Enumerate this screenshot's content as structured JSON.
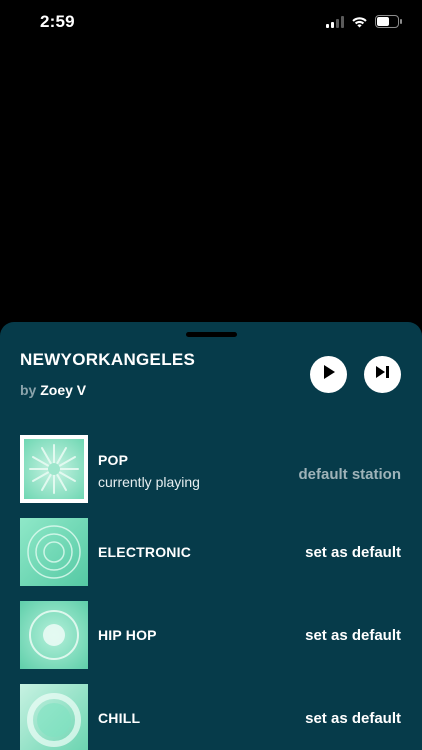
{
  "status_bar": {
    "time": "2:59"
  },
  "sheet": {
    "title": "NEWYORKANGELES",
    "by_word": "by",
    "author": "Zoey V"
  },
  "stations": [
    {
      "name": "POP",
      "subtitle": "currently playing",
      "action": "default station"
    },
    {
      "name": "ELECTRONIC",
      "subtitle": "",
      "action": "set as default"
    },
    {
      "name": "HIP HOP",
      "subtitle": "",
      "action": "set as default"
    },
    {
      "name": "CHILL",
      "subtitle": "",
      "action": "set as default"
    }
  ],
  "colors": {
    "sheet_bg": "#063b4a",
    "accent_mint": "#7fe3c2",
    "muted_text": "#9fb3b9"
  },
  "icons": [
    "cellular-signal-icon",
    "wifi-icon",
    "battery-icon",
    "play-icon",
    "skip-forward-icon"
  ]
}
